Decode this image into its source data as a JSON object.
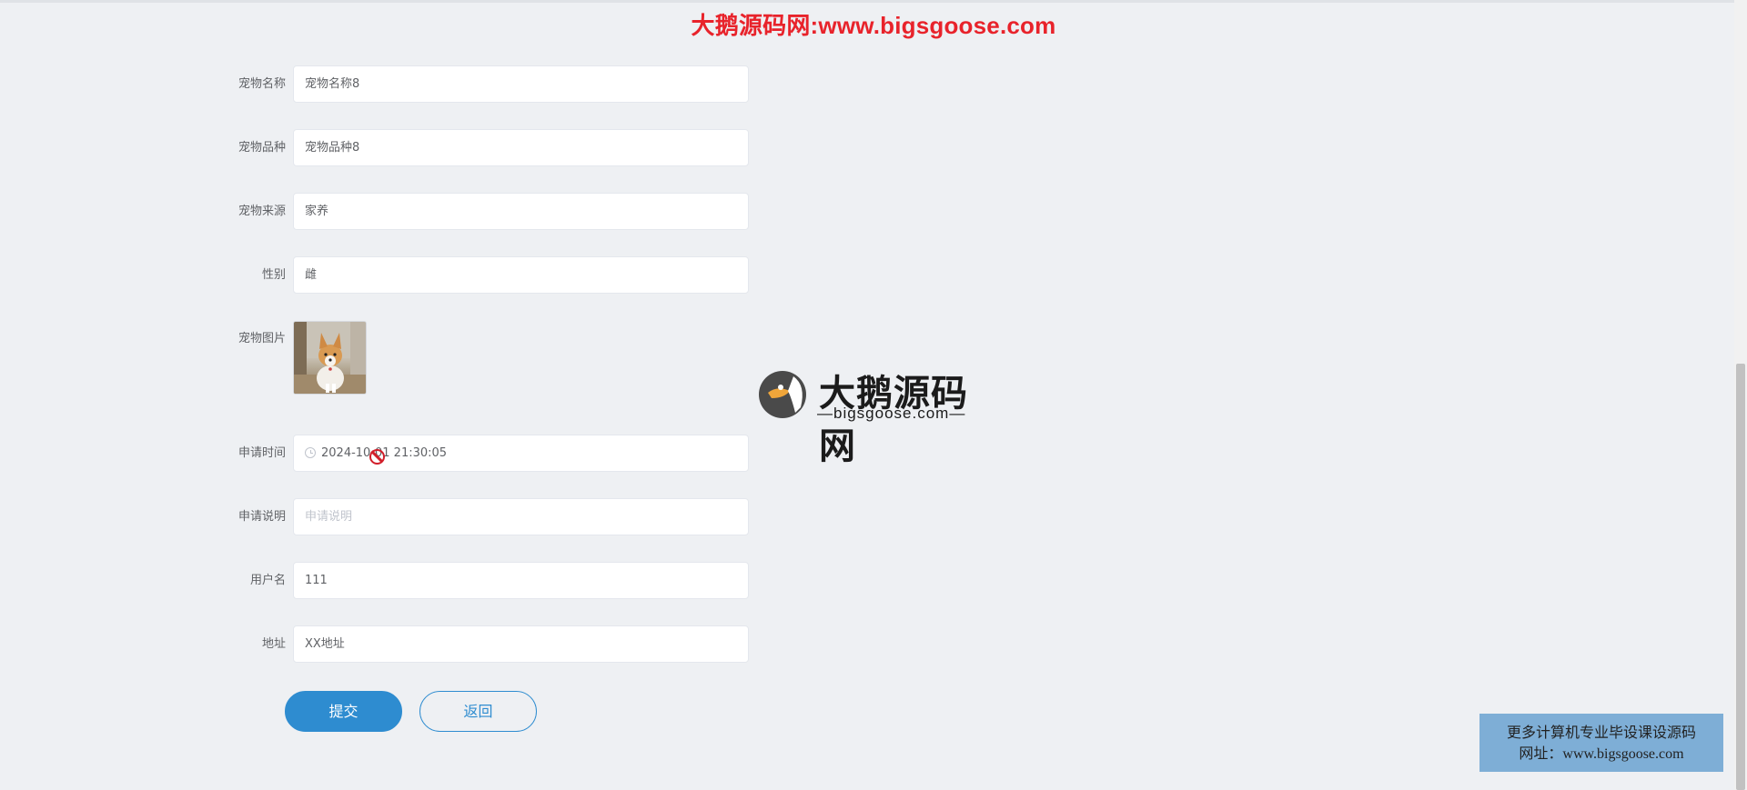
{
  "watermark": {
    "top_text": "大鹅源码网:www.bigsgoose.com",
    "logo_title": "大鹅源码网",
    "logo_subtitle": "—bigsgoose.com—",
    "promo_line1": "更多计算机专业毕设课设源码",
    "promo_line2": "网址：www.bigsgoose.com"
  },
  "form": {
    "pet_name": {
      "label": "宠物名称",
      "value": "宠物名称8"
    },
    "pet_breed": {
      "label": "宠物品种",
      "value": "宠物品种8"
    },
    "pet_source": {
      "label": "宠物来源",
      "value": "家养"
    },
    "gender": {
      "label": "性别",
      "value": "雌"
    },
    "pet_image": {
      "label": "宠物图片"
    },
    "apply_time": {
      "label": "申请时间",
      "value": "2024-10-01 21:30:05"
    },
    "apply_note": {
      "label": "申请说明",
      "placeholder": "申请说明"
    },
    "username": {
      "label": "用户名",
      "value": "111"
    },
    "address": {
      "label": "地址",
      "value": "XX地址"
    }
  },
  "buttons": {
    "submit": "提交",
    "back": "返回"
  },
  "colors": {
    "primary": "#2e8cd0",
    "watermark_red": "#e8232b",
    "page_bg": "#eef0f3",
    "promo_bg": "#7eaed6"
  },
  "icons": {
    "date": "clock-icon",
    "cursor": "not-allowed-icon",
    "logo": "goose-logo-icon"
  }
}
